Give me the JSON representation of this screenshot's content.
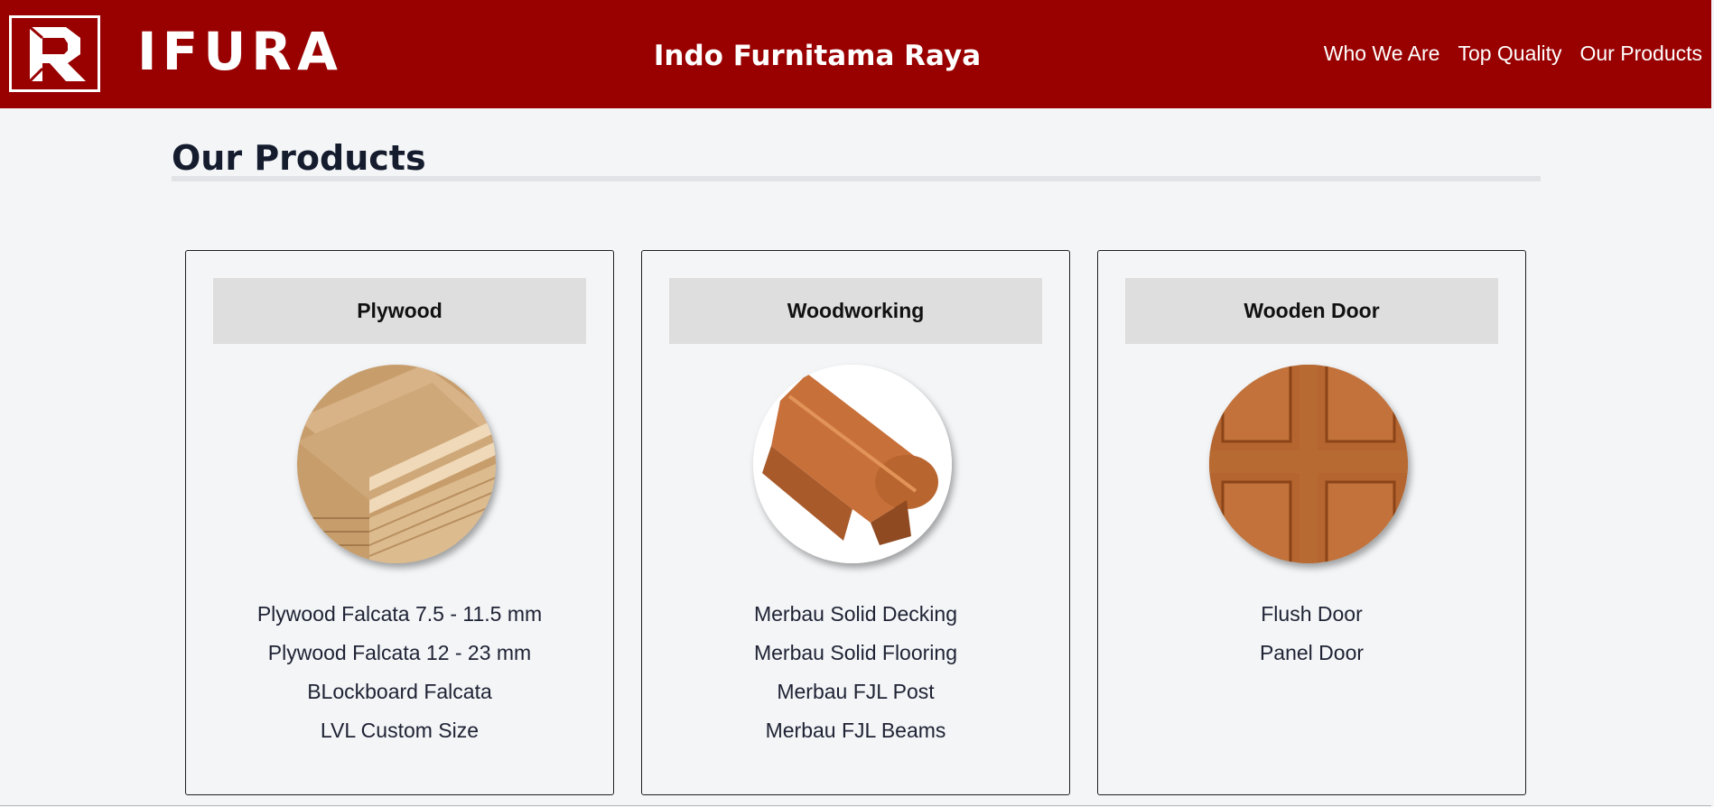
{
  "header": {
    "logo_text": "IFURA",
    "site_title": "Indo Furnitama Raya",
    "nav": [
      {
        "label": "Who We Are"
      },
      {
        "label": "Top Quality"
      },
      {
        "label": "Our Products"
      }
    ]
  },
  "page": {
    "title": "Our Products"
  },
  "products": [
    {
      "title": "Plywood",
      "icon": "plywood-stack-photo",
      "items": [
        "Plywood Falcata 7.5 - 11.5 mm",
        "Plywood Falcata 12 - 23 mm",
        "BLockboard Falcata",
        "LVL Custom Size"
      ]
    },
    {
      "title": "Woodworking",
      "icon": "wood-handrail-photo",
      "items": [
        "Merbau Solid Decking",
        "Merbau Solid Flooring",
        "Merbau FJL Post",
        "Merbau FJL Beams"
      ]
    },
    {
      "title": "Wooden Door",
      "icon": "wooden-door-photo",
      "items": [
        "Flush Door",
        "Panel Door"
      ]
    }
  ],
  "colors": {
    "header_bg": "#990000",
    "page_bg": "#f3f5f7",
    "card_head_bg": "#dedede",
    "text": "#1e2233"
  }
}
